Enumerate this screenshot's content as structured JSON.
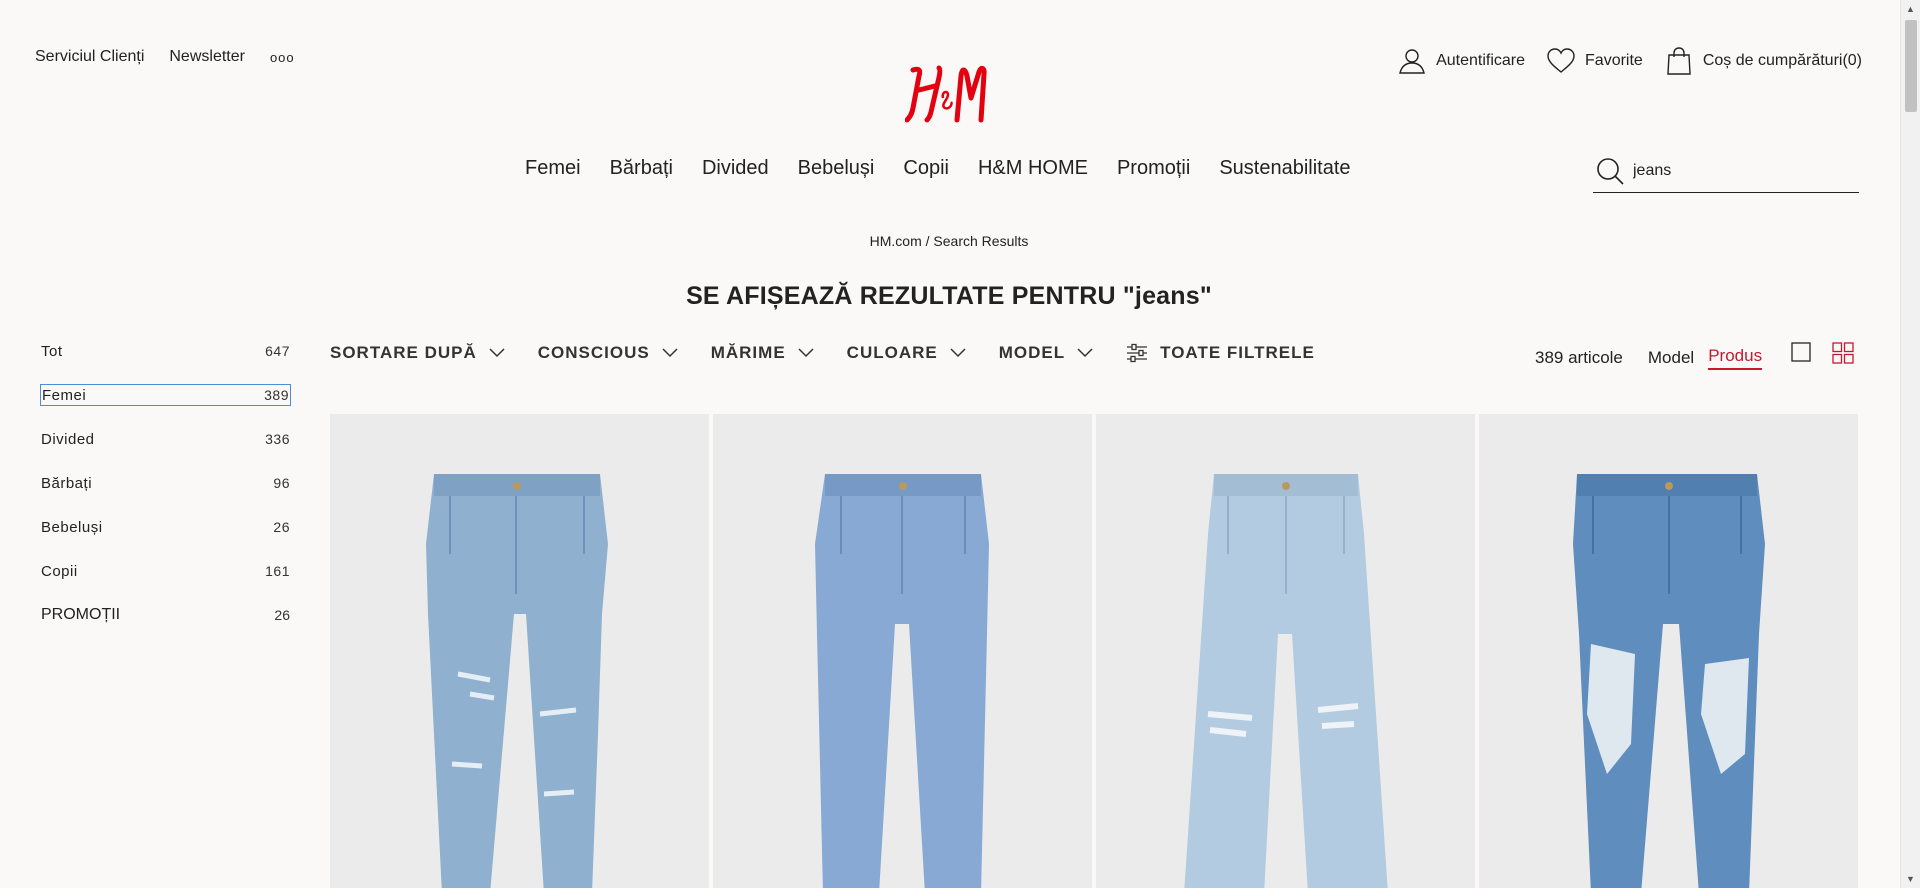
{
  "header": {
    "links": [
      "Serviciul Clienți",
      "Newsletter"
    ],
    "more_label": "ooo",
    "brand": "H&M",
    "account_label": "Autentificare",
    "favorites_label": "Favorite",
    "cart_label": "Coș de cumpărături(0)",
    "brand_color": "#e50010"
  },
  "nav": {
    "items": [
      "Femei",
      "Bărbați",
      "Divided",
      "Bebeluși",
      "Copii",
      "H&M HOME",
      "Promoții",
      "Sustenabilitate"
    ]
  },
  "search": {
    "value": "jeans",
    "icon": "search-icon"
  },
  "breadcrumb": "HM.com / Search Results",
  "page_title": "SE AFIȘEAZĂ REZULTATE PENTRU \"jeans\"",
  "sidebar": {
    "categories": [
      {
        "label": "Tot",
        "count": "647"
      },
      {
        "label": "Femei",
        "count": "389"
      },
      {
        "label": "Divided",
        "count": "336"
      },
      {
        "label": "Bărbați",
        "count": "96"
      },
      {
        "label": "Bebeluși",
        "count": "26"
      },
      {
        "label": "Copii",
        "count": "161"
      },
      {
        "label": "PROMOȚII",
        "count": "26"
      }
    ]
  },
  "filters": {
    "sort": "SORTARE DUPĂ",
    "conscious": "CONSCIOUS",
    "size": "MĂRIME",
    "color": "CULOARE",
    "model": "MODEL",
    "all": "TOATE FILTRELE"
  },
  "results": {
    "count": "389 articole",
    "view_model": "Model",
    "view_product": "Produs",
    "accent_color": "#c41a2e"
  },
  "products": [
    {
      "image": "ripped-mom-jeans-light-blue",
      "denim_color": "#8fb0cf"
    },
    {
      "image": "mom-jeans-medium-blue",
      "denim_color": "#87a9d4"
    },
    {
      "image": "wide-ripped-jeans-pale-blue",
      "denim_color": "#b3cbe0"
    },
    {
      "image": "heavily-ripped-mom-jeans-blue",
      "denim_color": "#5f8dbd"
    }
  ]
}
